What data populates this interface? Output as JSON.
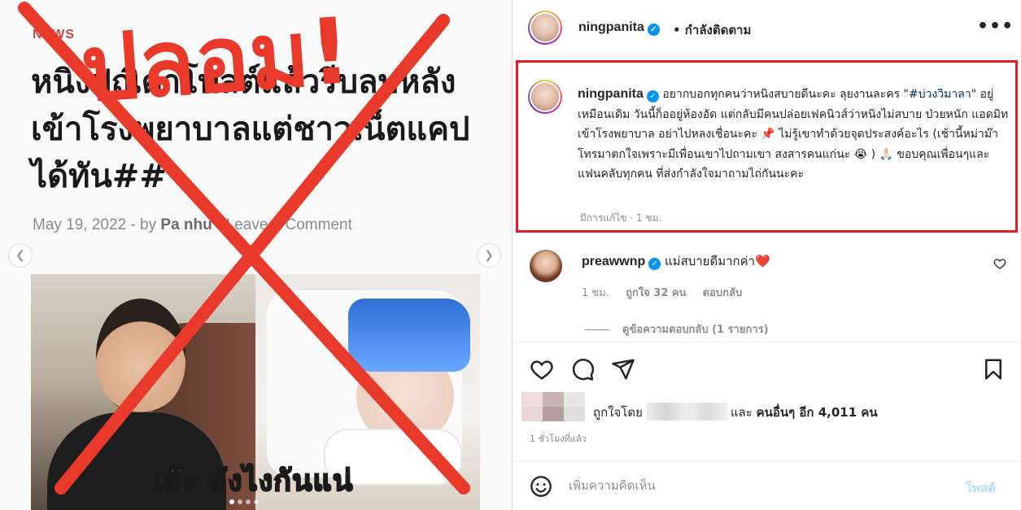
{
  "article": {
    "category": "NEWS",
    "title": "หนิงปณิตาโพสต์แล้วรีบลบหลังเข้าโรงพยาบาลแต่ชาวเน็ตแคปได้ทัน##",
    "date": "May 19, 2022",
    "sep1": "-",
    "by_prefix": "by",
    "author": "Pa nhu",
    "sep2": "-",
    "comment_link": "Leave a Comment",
    "image_caption": "เอ๊ะ  ยังไงกันแน่"
  },
  "overlay": {
    "fake_stamp": "ปลอม!",
    "color": "#e8392b"
  },
  "post": {
    "username": "ningpanita",
    "follow_state": "• กำลังติดตาม",
    "more_icon": "more-horizontal-icon",
    "caption_part1": "อยากบอกทุกคนว่าหนิงสบายดีนะคะ ลุยงานละคร \"",
    "hashtag": "#บ่วงวิมาลา",
    "caption_part2": "\" อยู่เหมือนเดิม วันนี้ก็ออยู่ห้องอัด แต่กลับมีคนปล่อยเฟคนิวส์ว่าหนิงไม่สบาย ป่วยหนัก แอดมิทเข้าโรงพยาบาล อย่าไปหลงเชื่อนะคะ 📌 ไม่รู้เขาทำด้วยจุดประสงค์อะไร (เช้านี้หม่าม๊าโทรมาตกใจเพราะมีเพื่อนเขาไปถามเขา สงสารคนแก่นะ 😭 ) 🙏🏻 ขอบคุณเพื่อนๆและแฟนคลับทุกคน ที่ส่งกำลังใจมาถามไถ่กันนะคะ",
    "caption_meta": "มีการแก้ไข · 1 ชม.",
    "highlight_color": "#e31b23"
  },
  "comment": {
    "username": "preawwnp",
    "text": "แม่สบายดีมากค่า❤️",
    "time": "1 ชม.",
    "likes": "ถูกใจ 32 คน",
    "reply": "ตอบกลับ",
    "view_replies": "ดูข้อความตอบกลับ (1 รายการ)"
  },
  "likes": {
    "liked_by": "ถูกใจโดย",
    "and": "และ",
    "others": "คนอื่นๆ อีก 4,011 คน"
  },
  "time_ago": "1 ชั่วโมงที่แล้ว",
  "comment_bar": {
    "placeholder": "เพิ่มความคิดเห็น",
    "post_label": "โพสต์",
    "post_color": "#b2dffc"
  },
  "icons": [
    "heart-icon",
    "comment-icon",
    "share-icon",
    "bookmark-icon",
    "emoji-icon",
    "verified-icon",
    "chevron-left-icon",
    "chevron-right-icon"
  ]
}
